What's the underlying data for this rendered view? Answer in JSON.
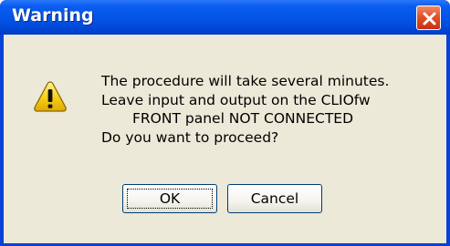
{
  "dialog": {
    "title": "Warning",
    "icon": "warning-icon",
    "message_lines": [
      "The procedure will take several minutes.",
      "Leave input and output on the CLIOfw",
      "FRONT panel NOT CONNECTED",
      "Do you want to proceed?"
    ],
    "ok_label": "OK",
    "cancel_label": "Cancel"
  },
  "colors": {
    "titlebar": "#0453e6",
    "client": "#ece9d8",
    "close_button": "#e2522a",
    "warning_yellow": "#f8d21a"
  }
}
